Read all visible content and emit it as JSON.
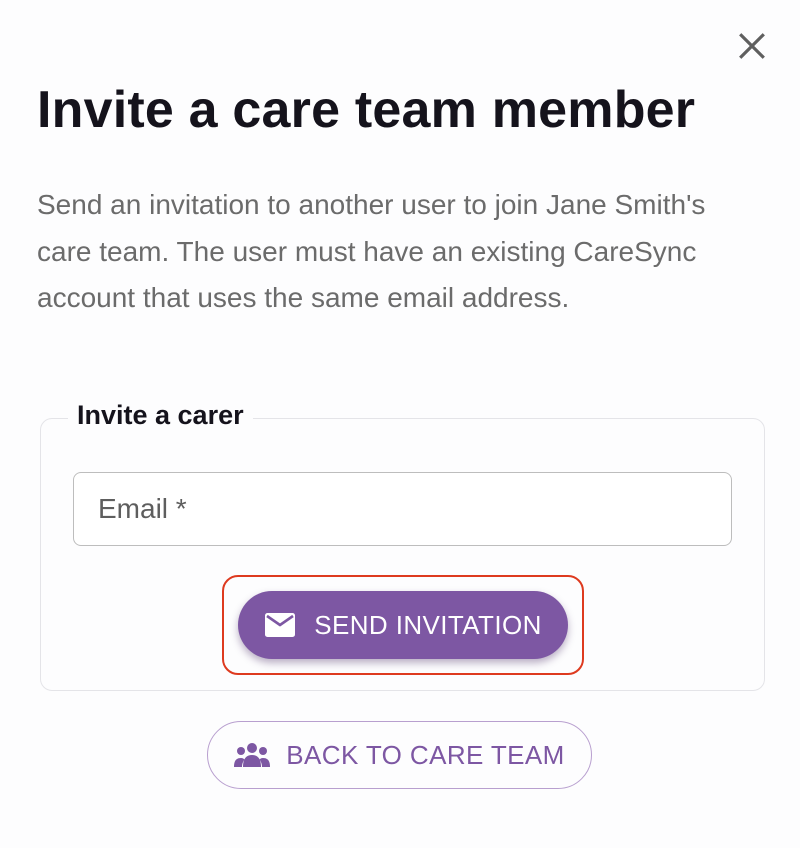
{
  "dialog": {
    "title": "Invite a care team member",
    "description": "Send an invitation to another user to join Jane Smith's care team. The user must have an existing CareSync account that uses the same email address.",
    "close_icon": "close-icon"
  },
  "invite_panel": {
    "legend": "Invite a carer",
    "email": {
      "value": "",
      "placeholder": "Email *"
    },
    "send_button": {
      "label": "SEND INVITATION",
      "icon": "mail-icon"
    }
  },
  "back_button": {
    "label": "BACK TO CARE TEAM",
    "icon": "group-icon"
  },
  "colors": {
    "accent": "#7d57a3",
    "highlight": "#de3a1f",
    "title_text": "#15131c",
    "body_text": "#6b6b6b"
  }
}
